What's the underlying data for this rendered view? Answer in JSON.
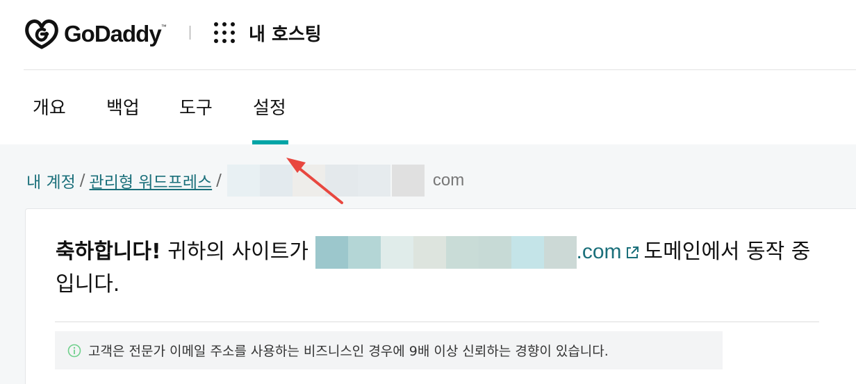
{
  "header": {
    "brand": "GoDaddy",
    "brand_tm": "™",
    "product_title": "내 호스팅"
  },
  "tabs": [
    {
      "label": "개요"
    },
    {
      "label": "백업"
    },
    {
      "label": "도구"
    },
    {
      "label": "설정",
      "active": true
    }
  ],
  "breadcrumb": {
    "account": "내 계정",
    "managed_wp": "관리형 워드프레스",
    "domain_suffix": "com"
  },
  "message": {
    "congrats": "축하합니다!",
    "text_before": " 귀하의 사이트가 ",
    "domain_suffix": ".com",
    "text_after": "도메인에서 동작 중입니다."
  },
  "tip": {
    "text": "고객은 전문가 이메일 주소를 사용하는 비즈니스인 경우에 9배 이상 신뢰하는 경향이 있습니다."
  },
  "colors": {
    "accent": "#00a4a6",
    "link": "#1a6f7a",
    "annotation_arrow": "#e8473f",
    "tip_icon": "#6fd08c"
  },
  "icons": {
    "brand": "godaddy-logo-icon",
    "apps": "app-grid-icon",
    "external": "external-link-icon",
    "tip": "info-circle-icon"
  }
}
